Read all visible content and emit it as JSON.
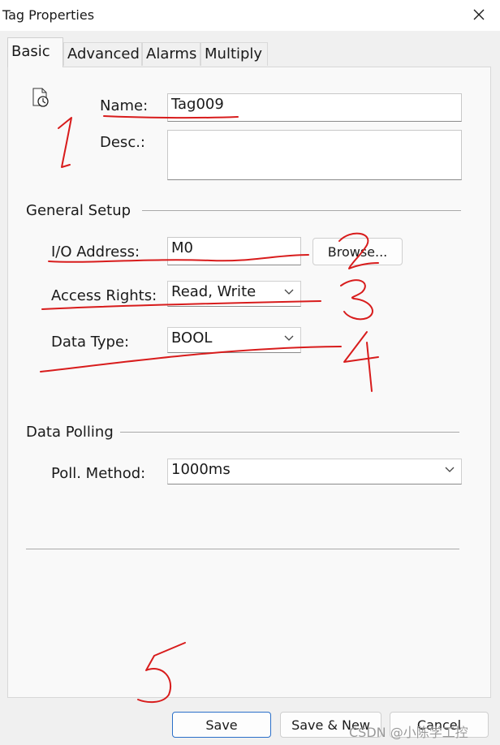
{
  "window": {
    "title": "Tag Properties"
  },
  "tabs": [
    {
      "label": "Basic",
      "active": true
    },
    {
      "label": "Advanced"
    },
    {
      "label": "Alarms"
    },
    {
      "label": "Multiply"
    }
  ],
  "basic": {
    "name_label": "Name:",
    "name_value": "Tag009",
    "desc_label": "Desc.:",
    "desc_value": "",
    "general_setup_heading": "General Setup",
    "io_address_label": "I/O Address:",
    "io_address_value": "M0",
    "browse_label": "Browse...",
    "access_rights_label": "Access Rights:",
    "access_rights_value": "Read, Write",
    "data_type_label": "Data Type:",
    "data_type_value": "BOOL",
    "data_polling_heading": "Data Polling",
    "poll_method_label": "Poll. Method:",
    "poll_method_value": "1000ms"
  },
  "footer": {
    "save_label": "Save",
    "save_new_label": "Save & New",
    "cancel_label": "Cancel"
  },
  "watermark": "CSDN @小陈学工控",
  "annotation_colors": {
    "ink": "#d81c1c",
    "accent": "#2a6fc9"
  }
}
